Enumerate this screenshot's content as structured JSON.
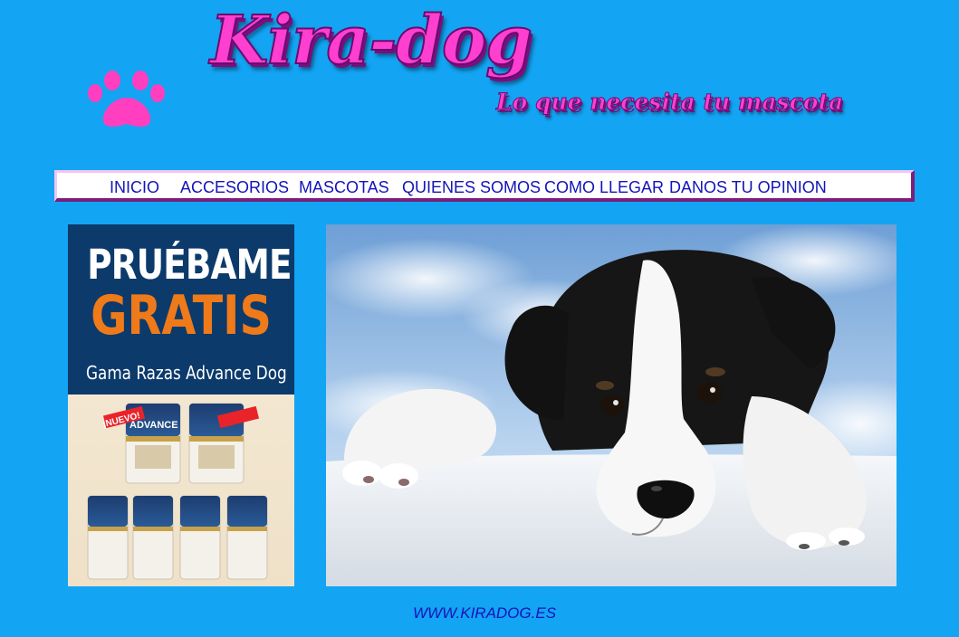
{
  "header": {
    "logo_title": "Kira-dog",
    "tagline": "Lo que necesita  tu mascota",
    "paw_icon": "paw-icon",
    "paw_color": "#ff3fbf"
  },
  "nav": {
    "items": [
      {
        "label": "Inicio"
      },
      {
        "label": "Accesorios"
      },
      {
        "label": "Mascotas"
      },
      {
        "label": "Quienes somos"
      },
      {
        "label": "Como llegar"
      },
      {
        "label": "Danos tu opinion"
      }
    ]
  },
  "ad": {
    "headline1": "PRUÉBAME",
    "headline2": "GRATIS",
    "subline": "Gama Razas Advance Dog",
    "badge": "¡NUEVO!",
    "brand": "ADVANCE"
  },
  "hero": {
    "image": "puppy-photo"
  },
  "footer": {
    "link": "WWW.KIRADOG.ES"
  },
  "colors": {
    "background": "#13a4f4",
    "nav_text": "#1414b8",
    "logo_pink": "#ff3fd0",
    "ad_navy": "#0c3a6b",
    "ad_orange": "#ef7a1a"
  }
}
